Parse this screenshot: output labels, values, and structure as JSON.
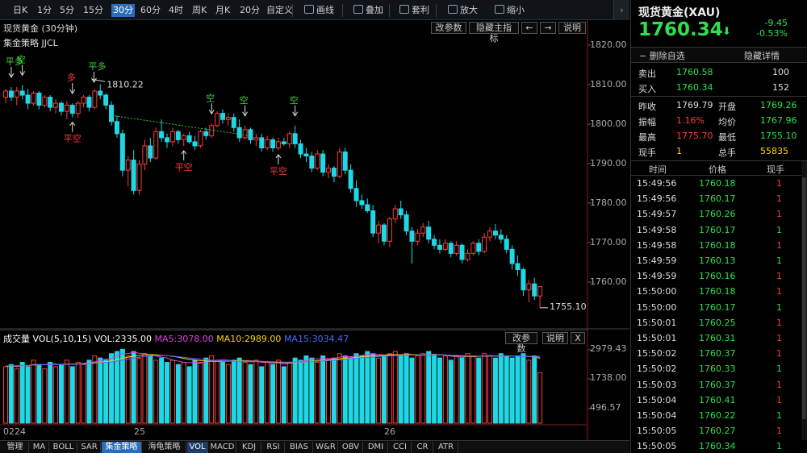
{
  "toolbar": {
    "items": [
      "日K",
      "1分",
      "5分",
      "15分",
      "30分",
      "60分",
      "4时",
      "周K",
      "月K",
      "20分",
      "自定义",
      "画线",
      "叠加",
      "套利",
      "放大",
      "缩小"
    ],
    "active_index": 4,
    "icons": [
      "pencil-icon",
      "stack-icon",
      "coin-bag-icon",
      "zoom-in-icon",
      "zoom-out-icon"
    ]
  },
  "main_panel": {
    "title": "现货黄金 (30分钟)",
    "indicator": "集金策略 JJCL",
    "buttons": [
      "改参数",
      "隐藏主指标",
      "←",
      "→",
      "说明"
    ],
    "y_axis_labels": [
      "1820.00",
      "1810.00",
      "1800.00",
      "1790.00",
      "1780.00",
      "1770.00",
      "1760.00"
    ],
    "annotations": {
      "high_label": "1810.22",
      "low_label": "1755.10",
      "signals": [
        {
          "text": "平多",
          "color": "#3fd23f"
        },
        {
          "text": "空",
          "color": "#3fd23f"
        },
        {
          "text": "多",
          "color": "#ff3b3b"
        },
        {
          "text": "平多",
          "color": "#3fd23f"
        },
        {
          "text": "空",
          "color": "#3fd23f"
        },
        {
          "text": "平空",
          "color": "#ff3b3b"
        },
        {
          "text": "平空",
          "color": "#ff3b3b"
        },
        {
          "text": "空",
          "color": "#3fd23f"
        },
        {
          "text": "空",
          "color": "#3fd23f"
        },
        {
          "text": "平空",
          "color": "#ff3b3b"
        }
      ]
    },
    "x_axis_labels": [
      "0224",
      "25",
      "26"
    ]
  },
  "volume_panel": {
    "title": "成交量",
    "vol_label": "VOL(5,10,15)",
    "vol_value": "VOL:2335.00",
    "ma5": "MA5:3078.00",
    "ma10": "MA10:2989.00",
    "ma15": "MA15:3034.47",
    "buttons": [
      "改参数",
      "说明",
      "X"
    ],
    "y_axis_labels": [
      "2979.43",
      "1738.00",
      "496.57"
    ],
    "colors": {
      "ma5": "#e040e0",
      "ma10": "#ffd400",
      "ma15": "#4a6cff",
      "label": "#ffffff"
    }
  },
  "bottom_tabs": [
    "管理",
    "MA",
    "BOLL",
    "SAR",
    "集金策略",
    "海龟策略",
    "VOL",
    "MACD",
    "KDJ",
    "RSI",
    "BIAS",
    "W&R",
    "OBV",
    "DMI",
    "CCI",
    "CR",
    "ATR"
  ],
  "bottom_active": [
    4,
    6
  ],
  "quote": {
    "name": "现货黄金(XAU)",
    "price": "1760.34",
    "change": "-9.45",
    "change_pct": "-0.53%",
    "delete_fav": "删除自选",
    "hide_detail": "隐藏详情",
    "sell_label": "卖出",
    "sell_price": "1760.58",
    "sell_vol": "100",
    "buy_label": "买入",
    "buy_price": "1760.34",
    "buy_vol": "152",
    "stats": [
      {
        "l1": "昨收",
        "v1": "1769.79",
        "c1": "white",
        "l2": "开盘",
        "v2": "1769.26",
        "c2": "green"
      },
      {
        "l1": "振幅",
        "v1": "1.16%",
        "c1": "red",
        "l2": "均价",
        "v2": "1767.96",
        "c2": "green"
      },
      {
        "l1": "最高",
        "v1": "1775.70",
        "c1": "red",
        "l2": "最低",
        "v2": "1755.10",
        "c2": "green"
      },
      {
        "l1": "现手",
        "v1": "1",
        "c1": "yellow",
        "l2": "总手",
        "v2": "55835",
        "c2": "yellow"
      }
    ]
  },
  "ticks": {
    "headers": [
      "时间",
      "价格",
      "现手"
    ],
    "rows": [
      {
        "time": "15:49:56",
        "price": "1760.18",
        "vol": "1",
        "vc": "red"
      },
      {
        "time": "15:49:56",
        "price": "1760.17",
        "vol": "1",
        "vc": "red"
      },
      {
        "time": "15:49:57",
        "price": "1760.26",
        "vol": "1",
        "vc": "red"
      },
      {
        "time": "15:49:58",
        "price": "1760.17",
        "vol": "1",
        "vc": "green"
      },
      {
        "time": "15:49:58",
        "price": "1760.18",
        "vol": "1",
        "vc": "red"
      },
      {
        "time": "15:49:59",
        "price": "1760.13",
        "vol": "1",
        "vc": "green"
      },
      {
        "time": "15:49:59",
        "price": "1760.16",
        "vol": "1",
        "vc": "red"
      },
      {
        "time": "15:50:00",
        "price": "1760.18",
        "vol": "1",
        "vc": "red"
      },
      {
        "time": "15:50:00",
        "price": "1760.17",
        "vol": "1",
        "vc": "green"
      },
      {
        "time": "15:50:01",
        "price": "1760.25",
        "vol": "1",
        "vc": "red"
      },
      {
        "time": "15:50:01",
        "price": "1760.31",
        "vol": "1",
        "vc": "red"
      },
      {
        "time": "15:50:02",
        "price": "1760.37",
        "vol": "1",
        "vc": "red"
      },
      {
        "time": "15:50:02",
        "price": "1760.33",
        "vol": "1",
        "vc": "green"
      },
      {
        "time": "15:50:03",
        "price": "1760.37",
        "vol": "1",
        "vc": "red"
      },
      {
        "time": "15:50:04",
        "price": "1760.41",
        "vol": "1",
        "vc": "red"
      },
      {
        "time": "15:50:04",
        "price": "1760.22",
        "vol": "1",
        "vc": "green"
      },
      {
        "time": "15:50:05",
        "price": "1760.27",
        "vol": "1",
        "vc": "red"
      },
      {
        "time": "15:50:05",
        "price": "1760.34",
        "vol": "1",
        "vc": "green"
      }
    ]
  },
  "chart_data": {
    "type": "candlestick",
    "price_range": [
      1750.5,
      1822.0
    ],
    "volume_range": [
      0,
      3600
    ],
    "ohlc": [
      [
        1807.0,
        1809.0,
        1805.5,
        1808.5
      ],
      [
        1808.5,
        1809.5,
        1806.0,
        1807.0
      ],
      [
        1807.0,
        1809.5,
        1805.0,
        1808.5
      ],
      [
        1808.5,
        1810.0,
        1806.5,
        1807.5
      ],
      [
        1807.5,
        1809.0,
        1804.0,
        1805.5
      ],
      [
        1805.5,
        1808.5,
        1805.0,
        1808.0
      ],
      [
        1808.0,
        1808.5,
        1804.0,
        1805.0
      ],
      [
        1805.0,
        1807.5,
        1804.5,
        1807.0
      ],
      [
        1807.0,
        1807.5,
        1803.5,
        1804.5
      ],
      [
        1804.5,
        1806.5,
        1803.0,
        1805.5
      ],
      [
        1805.5,
        1806.0,
        1802.5,
        1803.5
      ],
      [
        1803.5,
        1806.0,
        1801.5,
        1805.0
      ],
      [
        1805.0,
        1805.5,
        1802.0,
        1803.0
      ],
      [
        1803.0,
        1806.0,
        1802.0,
        1805.5
      ],
      [
        1805.5,
        1807.5,
        1804.5,
        1807.0
      ],
      [
        1807.0,
        1807.5,
        1803.5,
        1804.5
      ],
      [
        1804.5,
        1809.0,
        1804.0,
        1808.5
      ],
      [
        1808.5,
        1810.22,
        1806.5,
        1807.5
      ],
      [
        1807.5,
        1808.0,
        1804.0,
        1805.0
      ],
      [
        1805.0,
        1806.0,
        1800.0,
        1801.0
      ],
      [
        1801.0,
        1802.5,
        1797.0,
        1798.0
      ],
      [
        1798.0,
        1799.0,
        1787.5,
        1789.0
      ],
      [
        1789.0,
        1792.5,
        1785.0,
        1791.5
      ],
      [
        1791.5,
        1794.0,
        1783.0,
        1784.0
      ],
      [
        1784.0,
        1791.5,
        1783.0,
        1790.5
      ],
      [
        1790.5,
        1796.5,
        1789.0,
        1795.0
      ],
      [
        1795.0,
        1797.0,
        1791.0,
        1792.0
      ],
      [
        1792.0,
        1799.5,
        1791.5,
        1798.5
      ],
      [
        1798.5,
        1801.5,
        1796.0,
        1797.0
      ],
      [
        1797.0,
        1798.0,
        1794.5,
        1796.0
      ],
      [
        1796.0,
        1799.5,
        1795.0,
        1798.5
      ],
      [
        1798.5,
        1799.0,
        1795.5,
        1796.5
      ],
      [
        1796.5,
        1798.0,
        1795.0,
        1797.5
      ],
      [
        1797.5,
        1798.5,
        1795.5,
        1796.0
      ],
      [
        1796.0,
        1797.5,
        1794.0,
        1795.0
      ],
      [
        1795.0,
        1799.0,
        1794.5,
        1798.5
      ],
      [
        1798.5,
        1799.5,
        1796.5,
        1797.5
      ],
      [
        1797.5,
        1800.5,
        1797.0,
        1800.0
      ],
      [
        1800.0,
        1803.5,
        1799.5,
        1803.0
      ],
      [
        1803.0,
        1804.0,
        1800.5,
        1801.5
      ],
      [
        1801.5,
        1803.0,
        1800.0,
        1802.0
      ],
      [
        1802.0,
        1803.0,
        1798.5,
        1799.5
      ],
      [
        1799.5,
        1801.5,
        1796.0,
        1797.0
      ],
      [
        1797.0,
        1800.0,
        1796.5,
        1799.0
      ],
      [
        1799.0,
        1799.5,
        1795.5,
        1796.5
      ],
      [
        1796.5,
        1798.0,
        1795.0,
        1797.0
      ],
      [
        1797.0,
        1798.0,
        1793.5,
        1794.5
      ],
      [
        1794.5,
        1797.5,
        1794.0,
        1796.5
      ],
      [
        1796.5,
        1797.0,
        1793.5,
        1794.5
      ],
      [
        1794.5,
        1797.0,
        1794.0,
        1796.0
      ],
      [
        1796.0,
        1797.0,
        1795.0,
        1795.5
      ],
      [
        1795.5,
        1798.5,
        1794.5,
        1798.0
      ],
      [
        1798.0,
        1800.0,
        1794.5,
        1795.5
      ],
      [
        1795.5,
        1796.5,
        1792.0,
        1793.0
      ],
      [
        1793.0,
        1794.5,
        1791.0,
        1792.5
      ],
      [
        1792.5,
        1793.5,
        1788.5,
        1789.5
      ],
      [
        1789.5,
        1794.0,
        1789.0,
        1793.0
      ],
      [
        1793.0,
        1794.0,
        1787.5,
        1788.5
      ],
      [
        1788.5,
        1790.5,
        1787.0,
        1789.5
      ],
      [
        1789.5,
        1790.0,
        1786.0,
        1787.5
      ],
      [
        1787.5,
        1794.5,
        1787.0,
        1793.5
      ],
      [
        1793.5,
        1794.5,
        1788.0,
        1789.0
      ],
      [
        1789.0,
        1790.5,
        1783.5,
        1784.5
      ],
      [
        1784.5,
        1786.5,
        1780.0,
        1781.5
      ],
      [
        1781.5,
        1783.0,
        1779.5,
        1780.5
      ],
      [
        1780.5,
        1782.0,
        1778.5,
        1779.0
      ],
      [
        1779.0,
        1780.5,
        1772.5,
        1773.5
      ],
      [
        1773.5,
        1776.5,
        1771.0,
        1775.5
      ],
      [
        1775.5,
        1776.0,
        1770.5,
        1771.5
      ],
      [
        1771.5,
        1777.5,
        1770.0,
        1777.0
      ],
      [
        1777.0,
        1780.5,
        1776.0,
        1779.5
      ],
      [
        1779.5,
        1781.5,
        1777.0,
        1778.0
      ],
      [
        1778.0,
        1779.0,
        1773.0,
        1774.0
      ],
      [
        1774.0,
        1775.0,
        1766.0,
        1771.5
      ],
      [
        1771.5,
        1774.5,
        1770.5,
        1773.5
      ],
      [
        1773.5,
        1776.0,
        1772.5,
        1775.0
      ],
      [
        1775.0,
        1776.5,
        1771.0,
        1772.0
      ],
      [
        1772.0,
        1773.0,
        1769.5,
        1770.5
      ],
      [
        1770.5,
        1772.0,
        1768.5,
        1769.5
      ],
      [
        1769.5,
        1772.0,
        1769.0,
        1771.0
      ],
      [
        1771.0,
        1771.5,
        1767.5,
        1768.5
      ],
      [
        1768.5,
        1771.5,
        1768.0,
        1770.5
      ],
      [
        1770.5,
        1771.0,
        1766.0,
        1767.0
      ],
      [
        1767.0,
        1769.5,
        1766.5,
        1768.5
      ],
      [
        1768.5,
        1771.5,
        1768.0,
        1771.0
      ],
      [
        1771.0,
        1772.0,
        1768.0,
        1769.0
      ],
      [
        1769.0,
        1773.5,
        1768.5,
        1772.5
      ],
      [
        1772.5,
        1775.0,
        1771.5,
        1774.0
      ],
      [
        1774.0,
        1775.7,
        1772.0,
        1773.0
      ],
      [
        1773.0,
        1774.5,
        1771.0,
        1772.0
      ],
      [
        1772.0,
        1773.0,
        1768.5,
        1769.5
      ],
      [
        1769.5,
        1770.5,
        1764.5,
        1766.0
      ],
      [
        1766.0,
        1768.0,
        1763.0,
        1764.5
      ],
      [
        1764.5,
        1765.0,
        1758.0,
        1759.5
      ],
      [
        1759.5,
        1762.0,
        1756.5,
        1761.0
      ],
      [
        1761.0,
        1762.5,
        1757.0,
        1758.0
      ],
      [
        1758.0,
        1760.5,
        1755.1,
        1760.34
      ]
    ],
    "volume": [
      2600,
      2700,
      2500,
      2800,
      2600,
      2900,
      2700,
      2500,
      2800,
      2600,
      2700,
      2900,
      2600,
      2800,
      2700,
      2900,
      3100,
      3000,
      2900,
      3200,
      3300,
      3400,
      3100,
      3300,
      3000,
      3200,
      3100,
      2900,
      3000,
      2800,
      2900,
      2700,
      2800,
      2600,
      2900,
      2800,
      3000,
      3100,
      2900,
      2800,
      2700,
      2900,
      3000,
      2800,
      2700,
      2900,
      2600,
      2800,
      2700,
      2900,
      2600,
      2800,
      3000,
      2900,
      3100,
      3000,
      2800,
      3100,
      2900,
      3000,
      3200,
      3100,
      3000,
      3200,
      3100,
      3300,
      3200,
      3000,
      3100,
      3200,
      3300,
      3100,
      3200,
      3000,
      3100,
      3200,
      3300,
      3100,
      3000,
      3100,
      2900,
      3100,
      3000,
      3200,
      3100,
      3000,
      3200,
      3100,
      3000,
      3200,
      3100,
      3000,
      3100,
      3200,
      2900,
      3100,
      2335
    ],
    "ma5": [
      2600,
      2650,
      2600,
      2650,
      2640,
      2700,
      2700,
      2700,
      2720,
      2720,
      2700,
      2720,
      2720,
      2720,
      2760,
      2780,
      2820,
      2900,
      2940,
      2980,
      3100,
      3200,
      3200,
      3260,
      3220,
      3200,
      3140,
      3100,
      3040,
      3000,
      2900,
      2860,
      2800,
      2780,
      2800,
      2760,
      2820,
      2880,
      2900,
      2920,
      2900,
      2880,
      2860,
      2840,
      2820,
      2840,
      2800,
      2800,
      2760,
      2780,
      2720,
      2760,
      2800,
      2840,
      2880,
      2960,
      2960,
      2980,
      2980,
      2960,
      3040,
      3060,
      3060,
      3100,
      3120,
      3180,
      3180,
      3160,
      3140,
      3160,
      3160,
      3140,
      3180,
      3160,
      3140,
      3120,
      3160,
      3180,
      3140,
      3120,
      3080,
      3060,
      3040,
      3080,
      3060,
      3080,
      3100,
      3120,
      3100,
      3100,
      3100,
      3080,
      3080,
      3100,
      3060,
      3080,
      3078
    ],
    "ma10": [
      2620,
      2630,
      2640,
      2650,
      2660,
      2680,
      2690,
      2690,
      2700,
      2710,
      2710,
      2720,
      2720,
      2730,
      2740,
      2760,
      2780,
      2800,
      2840,
      2870,
      2920,
      2990,
      3040,
      3090,
      3120,
      3150,
      3160,
      3150,
      3130,
      3110,
      3080,
      3040,
      2980,
      2940,
      2910,
      2880,
      2860,
      2850,
      2850,
      2850,
      2860,
      2870,
      2880,
      2880,
      2870,
      2860,
      2840,
      2830,
      2810,
      2800,
      2790,
      2790,
      2790,
      2800,
      2810,
      2840,
      2880,
      2900,
      2920,
      2940,
      2960,
      2990,
      3010,
      3030,
      3050,
      3080,
      3100,
      3110,
      3120,
      3140,
      3150,
      3150,
      3160,
      3160,
      3150,
      3140,
      3150,
      3160,
      3150,
      3140,
      3120,
      3100,
      3090,
      3080,
      3080,
      3080,
      3080,
      3090,
      3090,
      3090,
      3090,
      3090,
      3080,
      3080,
      3070,
      3060,
      2989
    ],
    "ma15": [
      2640,
      2640,
      2650,
      2650,
      2660,
      2670,
      2680,
      2690,
      2690,
      2700,
      2700,
      2710,
      2710,
      2720,
      2730,
      2740,
      2760,
      2780,
      2800,
      2820,
      2860,
      2900,
      2950,
      3000,
      3040,
      3070,
      3090,
      3110,
      3120,
      3110,
      3090,
      3060,
      3030,
      3000,
      2980,
      2950,
      2930,
      2900,
      2880,
      2870,
      2870,
      2860,
      2860,
      2860,
      2860,
      2850,
      2850,
      2840,
      2830,
      2820,
      2810,
      2810,
      2810,
      2810,
      2820,
      2830,
      2850,
      2870,
      2880,
      2900,
      2920,
      2950,
      2970,
      2990,
      3010,
      3030,
      3050,
      3070,
      3090,
      3100,
      3110,
      3120,
      3130,
      3140,
      3140,
      3140,
      3140,
      3140,
      3140,
      3140,
      3130,
      3120,
      3110,
      3100,
      3100,
      3090,
      3090,
      3090,
      3090,
      3090,
      3090,
      3080,
      3080,
      3070,
      3060,
      3050,
      3034
    ]
  }
}
